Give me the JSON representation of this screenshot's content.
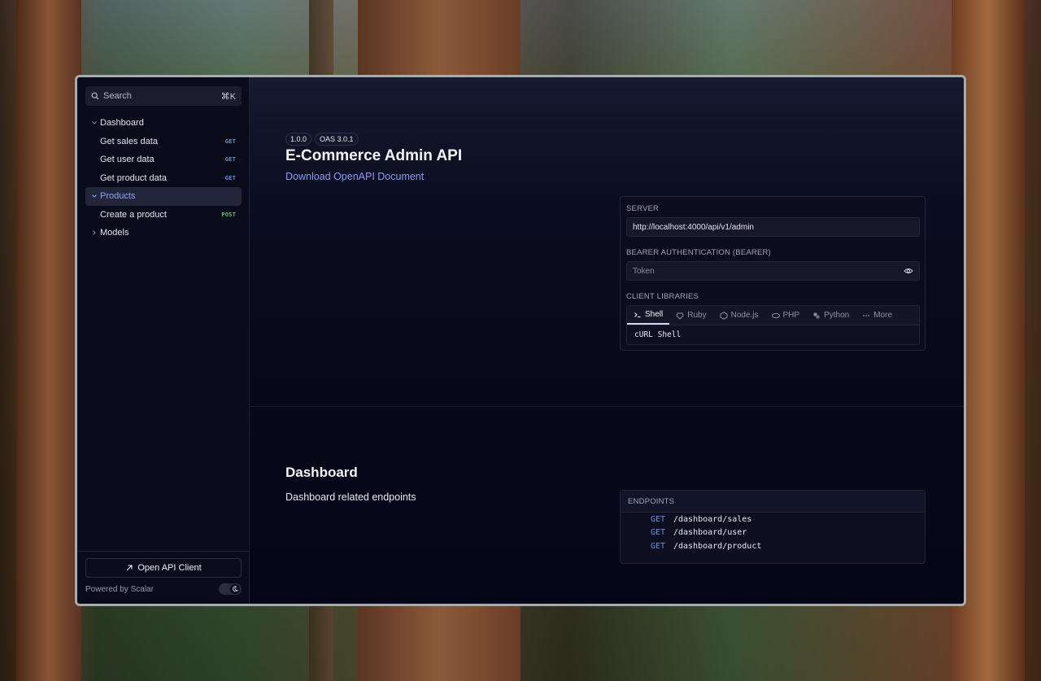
{
  "sidebar": {
    "search": {
      "label": "Search",
      "shortcut": "⌘K"
    },
    "items": [
      {
        "label": "Dashboard",
        "type": "group",
        "expanded": true
      },
      {
        "label": "Get sales data",
        "method": "GET"
      },
      {
        "label": "Get user data",
        "method": "GET"
      },
      {
        "label": "Get product data",
        "method": "GET"
      },
      {
        "label": "Products",
        "type": "group",
        "expanded": true,
        "active": true
      },
      {
        "label": "Create a product",
        "method": "POST"
      },
      {
        "label": "Models",
        "type": "group",
        "expanded": false
      }
    ],
    "footer": {
      "open_client": "Open API Client",
      "powered_by": "Powered by Scalar"
    }
  },
  "intro": {
    "version": "1.0.0",
    "oas": "OAS 3.0.1",
    "title": "E-Commerce Admin API",
    "download": "Download OpenAPI Document"
  },
  "client": {
    "server_label": "SERVER",
    "server_url": "http://localhost:4000/api/v1/admin",
    "auth_label": "BEARER AUTHENTICATION (BEARER)",
    "token_placeholder": "Token",
    "libraries_label": "CLIENT LIBRARIES",
    "tabs": [
      "Shell",
      "Ruby",
      "Node.js",
      "PHP",
      "Python",
      "More"
    ],
    "active_tab": "Shell",
    "code": "cURL Shell"
  },
  "dashboard": {
    "title": "Dashboard",
    "description": "Dashboard related endpoints",
    "endpoints_label": "ENDPOINTS",
    "endpoints": [
      {
        "method": "GET",
        "path": "/dashboard/sales"
      },
      {
        "method": "GET",
        "path": "/dashboard/user"
      },
      {
        "method": "GET",
        "path": "/dashboard/product"
      }
    ]
  },
  "colors": {
    "accent": "#8ea4ff",
    "get": "#6b8fd8",
    "post": "#5fbf6a",
    "background": "#0a0b1a"
  }
}
